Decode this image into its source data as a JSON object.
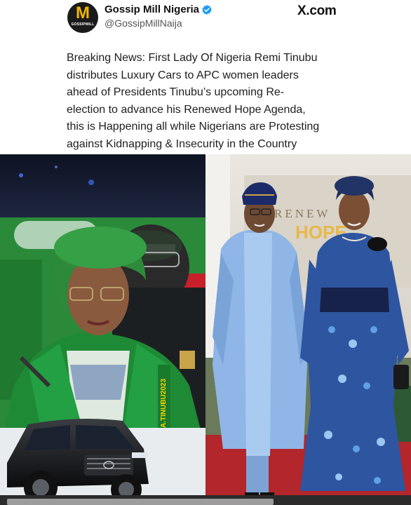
{
  "account": {
    "avatar_letter": "M",
    "avatar_text": "GOSSIPMILL",
    "name": "Gossip Mill Nigeria",
    "handle": "@GossipMillNaija"
  },
  "source": "X.com",
  "post": {
    "lines": [
      "Breaking News: First Lady Of Nigeria Remi Tinubu",
      "distributes Luxury Cars to APC women leaders",
      "ahead of Presidents Tinubu’s upcoming Re-",
      "election to advance his Renewed Hope Agenda,",
      "this is Happening all while Nigerians are Protesting",
      "against Kidnapping & Insecurity in the Country"
    ]
  },
  "images": {
    "left": {
      "sash_text": "A.TINUBU2023"
    },
    "right": {
      "backdrop_text": "RENEW",
      "backdrop_text_2": "HOPE"
    }
  },
  "colors": {
    "verified": "#1d9bf0",
    "gown": "#1d6b2c",
    "agbada": "#8fb6e6",
    "carpet": "#b3262b"
  }
}
